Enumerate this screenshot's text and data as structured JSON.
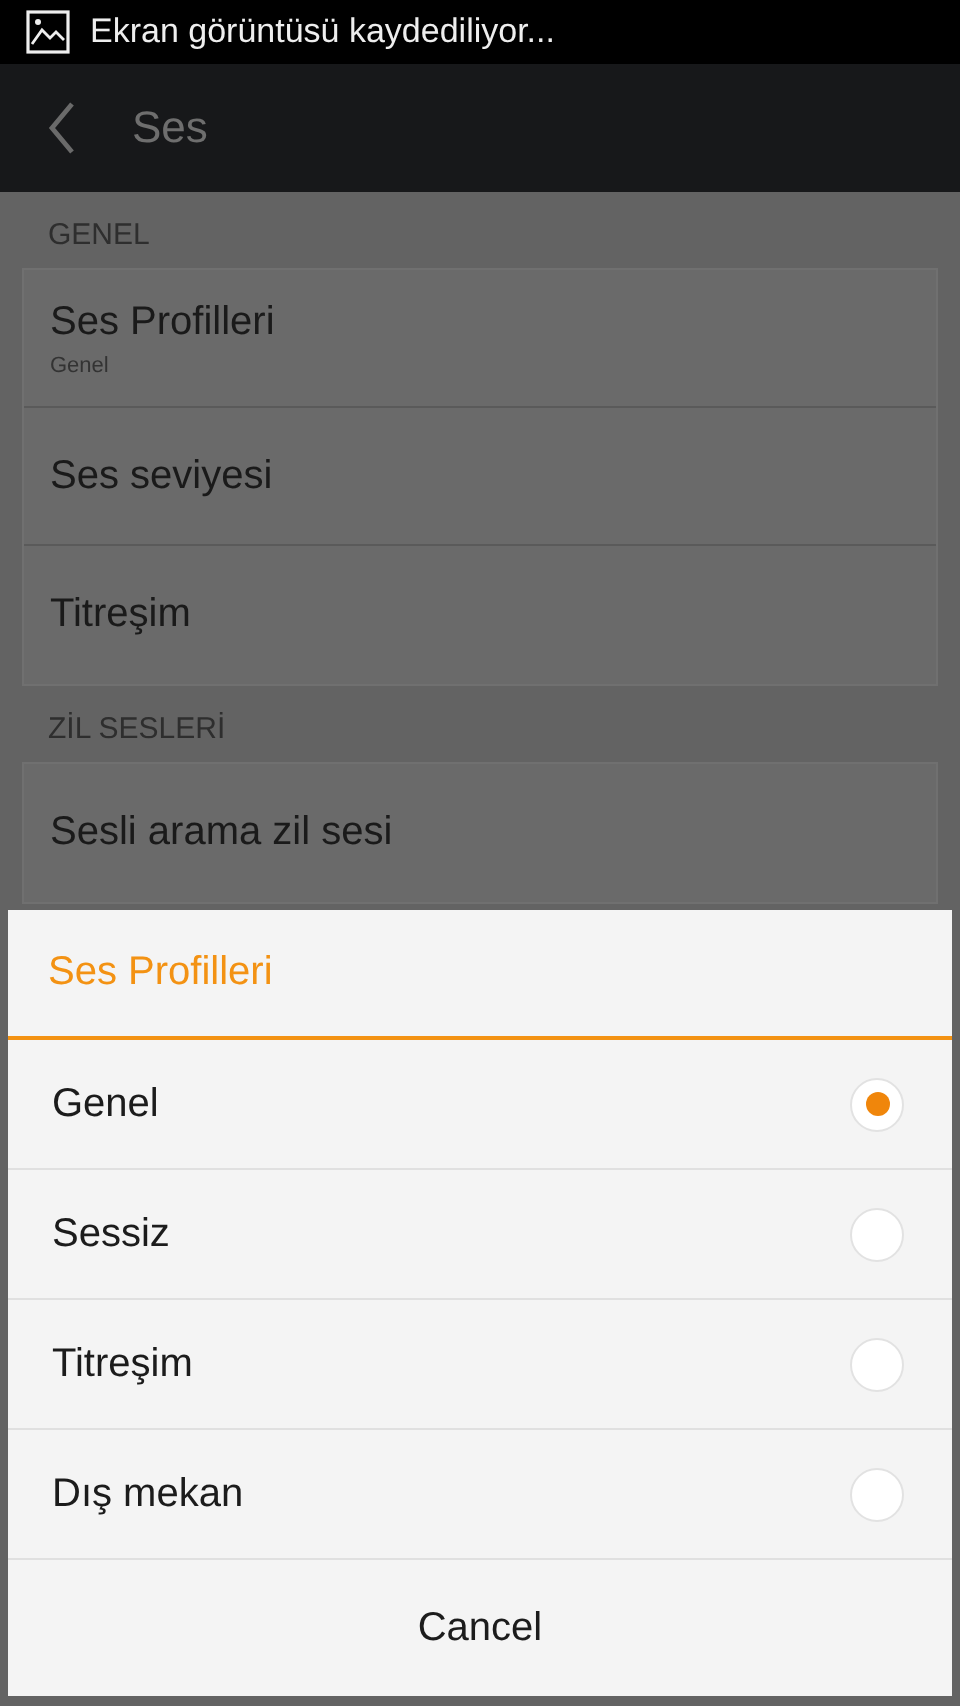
{
  "status_bar": {
    "notification": "Ekran görüntüsü kaydediliyor..."
  },
  "app_bar": {
    "title": "Ses"
  },
  "sections": [
    {
      "header": "GENEL",
      "items": [
        {
          "title": "Ses Profilleri",
          "subtitle": "Genel"
        },
        {
          "title": "Ses seviyesi"
        },
        {
          "title": "Titreşim"
        }
      ]
    },
    {
      "header": "ZİL SESLERİ",
      "items": [
        {
          "title": "Sesli arama zil sesi"
        }
      ]
    }
  ],
  "dialog": {
    "title": "Ses Profilleri",
    "options": [
      {
        "label": "Genel",
        "selected": true
      },
      {
        "label": "Sessiz",
        "selected": false
      },
      {
        "label": "Titreşim",
        "selected": false
      },
      {
        "label": "Dış mekan",
        "selected": false
      }
    ],
    "cancel": "Cancel"
  }
}
